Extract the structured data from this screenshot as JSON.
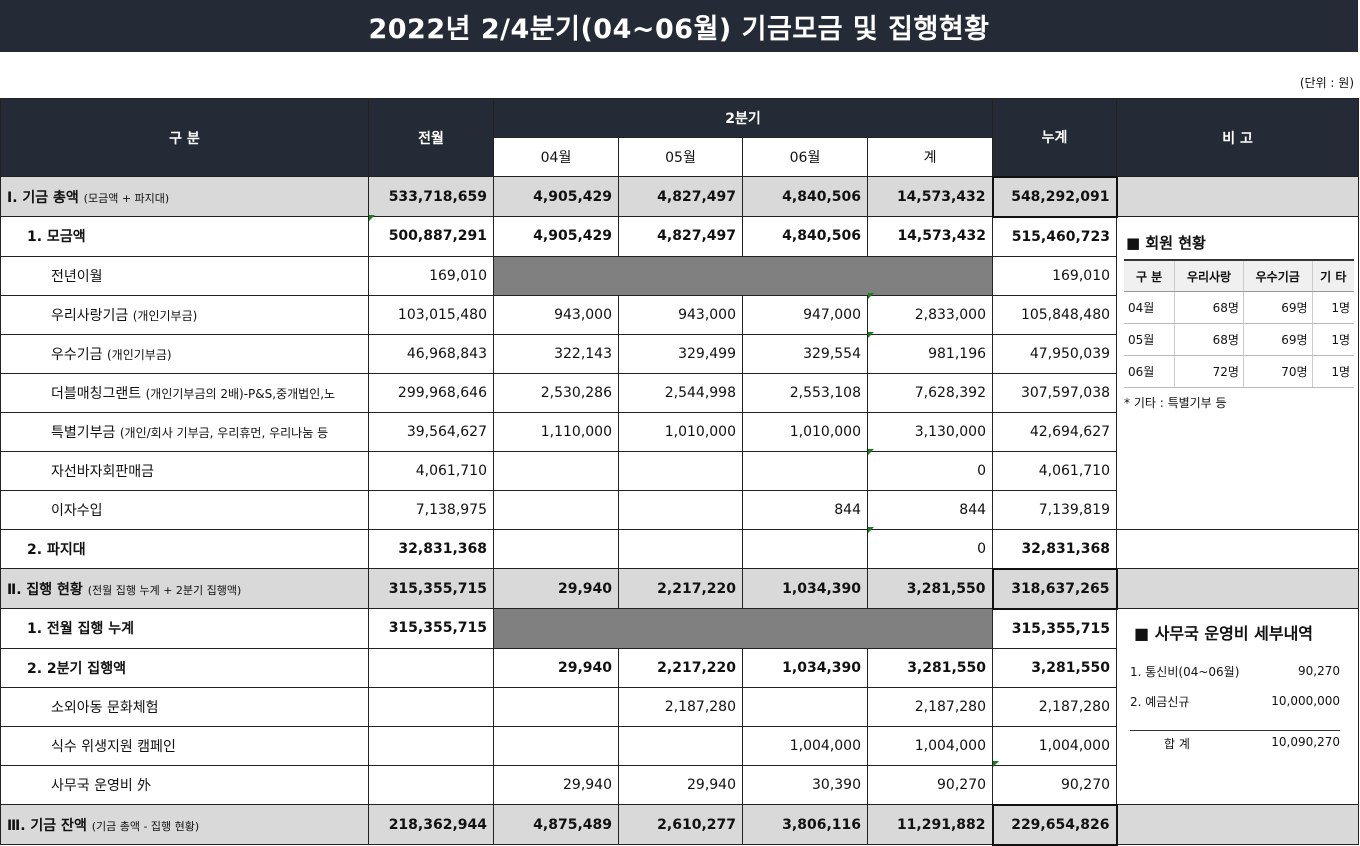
{
  "title": "2022년 2/4분기(04~06월) 기금모금 및 집행현황",
  "unit": "(단위 : 원)",
  "header": {
    "category": "구 분",
    "prev": "전월",
    "quarter": "2분기",
    "m04": "04월",
    "m05": "05월",
    "m06": "06월",
    "sum": "계",
    "cumulative": "누계",
    "note": "비 고"
  },
  "rows": {
    "r1": {
      "label": "Ⅰ. 기금 총액",
      "sub": "(모금액 + 파지대)",
      "prev": "533,718,659",
      "m04": "4,905,429",
      "m05": "4,827,497",
      "m06": "4,840,506",
      "sum": "14,573,432",
      "cum": "548,292,091"
    },
    "r2": {
      "label": "1. 모금액",
      "prev": "500,887,291",
      "m04": "4,905,429",
      "m05": "4,827,497",
      "m06": "4,840,506",
      "sum": "14,573,432",
      "cum": "515,460,723"
    },
    "r3": {
      "label": "전년이월",
      "prev": "169,010",
      "cum": "169,010"
    },
    "r4": {
      "label": "우리사랑기금",
      "sub": "(개인기부금)",
      "prev": "103,015,480",
      "m04": "943,000",
      "m05": "943,000",
      "m06": "947,000",
      "sum": "2,833,000",
      "cum": "105,848,480"
    },
    "r5": {
      "label": "우수기금",
      "sub": "(개인기부금)",
      "prev": "46,968,843",
      "m04": "322,143",
      "m05": "329,499",
      "m06": "329,554",
      "sum": "981,196",
      "cum": "47,950,039"
    },
    "r6": {
      "label": "더블매칭그랜트",
      "sub": "(개인기부금의 2배)-P&S,중개법인,노",
      "prev": "299,968,646",
      "m04": "2,530,286",
      "m05": "2,544,998",
      "m06": "2,553,108",
      "sum": "7,628,392",
      "cum": "307,597,038"
    },
    "r7": {
      "label": "특별기부금",
      "sub": "(개인/회사 기부금, 우리휴먼, 우리나눔 등",
      "prev": "39,564,627",
      "m04": "1,110,000",
      "m05": "1,010,000",
      "m06": "1,010,000",
      "sum": "3,130,000",
      "cum": "42,694,627"
    },
    "r8": {
      "label": "자선바자회판매금",
      "prev": "4,061,710",
      "sum": "0",
      "cum": "4,061,710"
    },
    "r9": {
      "label": "이자수입",
      "prev": "7,138,975",
      "m06": "844",
      "sum": "844",
      "cum": "7,139,819"
    },
    "r10": {
      "label": "2. 파지대",
      "prev": "32,831,368",
      "sum": "0",
      "cum": "32,831,368"
    },
    "r11": {
      "label": "Ⅱ. 집행 현황",
      "sub": "(전월 집행 누계 + 2분기 집행액)",
      "prev": "315,355,715",
      "m04": "29,940",
      "m05": "2,217,220",
      "m06": "1,034,390",
      "sum": "3,281,550",
      "cum": "318,637,265"
    },
    "r12": {
      "label": "1. 전월 집행 누계",
      "prev": "315,355,715",
      "cum": "315,355,715"
    },
    "r13": {
      "label": "2. 2분기 집행액",
      "m04": "29,940",
      "m05": "2,217,220",
      "m06": "1,034,390",
      "sum": "3,281,550",
      "cum": "3,281,550"
    },
    "r14": {
      "label": "소외아동 문화체험",
      "m05": "2,187,280",
      "sum": "2,187,280",
      "cum": "2,187,280"
    },
    "r15": {
      "label": "식수 위생지원 캠페인",
      "m06": "1,004,000",
      "sum": "1,004,000",
      "cum": "1,004,000"
    },
    "r16": {
      "label": "사무국 운영비 外",
      "m04": "29,940",
      "m05": "29,940",
      "m06": "30,390",
      "sum": "90,270",
      "cum": "90,270"
    },
    "r17": {
      "label": "Ⅲ. 기금 잔액",
      "sub": "(기금 총액 - 집행 현황)",
      "prev": "218,362,944",
      "m04": "4,875,489",
      "m05": "2,610,277",
      "m06": "3,806,116",
      "sum": "11,291,882",
      "cum": "229,654,826"
    }
  },
  "members": {
    "title": "■ 회원 현황",
    "headers": [
      "구 분",
      "우리사랑",
      "우수기금",
      "기 타"
    ],
    "rows": [
      [
        "04월",
        "68명",
        "69명",
        "1명"
      ],
      [
        "05월",
        "68명",
        "69명",
        "1명"
      ],
      [
        "06월",
        "72명",
        "70명",
        "1명"
      ]
    ],
    "note": "* 기타 : 특별기부 등"
  },
  "office": {
    "title": "■ 사무국 운영비 세부내역",
    "items": [
      {
        "label": "1. 통신비(04~06월)",
        "value": "90,270"
      },
      {
        "label": "2. 예금신규",
        "value": "10,000,000"
      }
    ],
    "total_label": "합 계",
    "total_value": "10,090,270"
  }
}
